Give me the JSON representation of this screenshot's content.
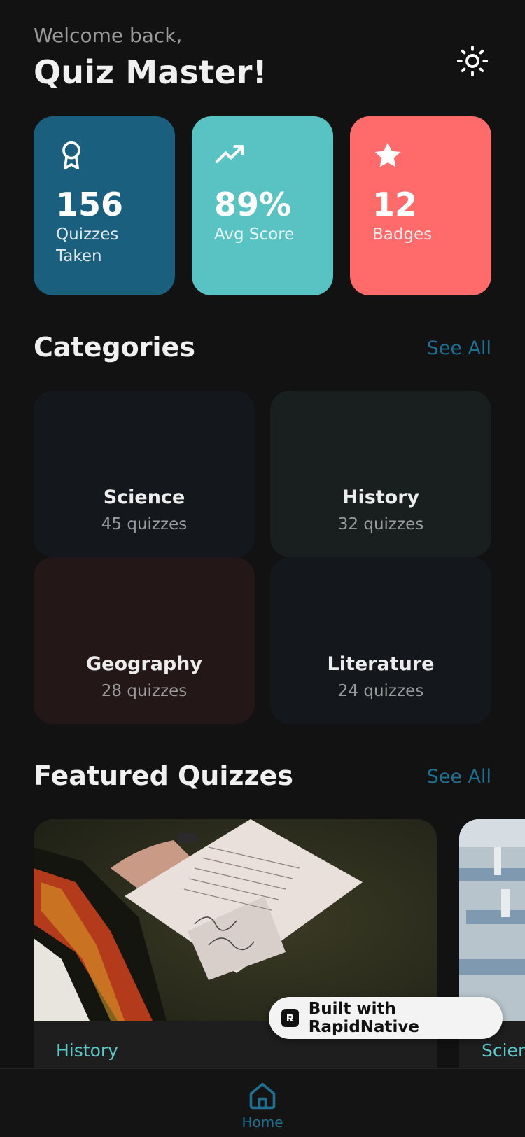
{
  "header": {
    "welcome": "Welcome back,",
    "username": "Quiz Master!",
    "theme_icon": "sun-icon"
  },
  "stats": [
    {
      "icon": "award-icon",
      "value": "156",
      "label": "Quizzes Taken",
      "color": "#1b5f7e"
    },
    {
      "icon": "trending-up-icon",
      "value": "89%",
      "label": "Avg Score",
      "color": "#59c3c4"
    },
    {
      "icon": "star-icon",
      "value": "12",
      "label": "Badges",
      "color": "#ff6b6b"
    }
  ],
  "categories_section": {
    "title": "Categories",
    "see_all": "See All",
    "items": [
      {
        "name": "Science",
        "count": "45 quizzes",
        "color": "#14181c"
      },
      {
        "name": "History",
        "count": "32 quizzes",
        "color": "#181f1e"
      },
      {
        "name": "Geography",
        "count": "28 quizzes",
        "color": "#231718"
      },
      {
        "name": "Literature",
        "count": "24 quizzes",
        "color": "#14181c"
      }
    ]
  },
  "featured_section": {
    "title": "Featured Quizzes",
    "see_all": "See All",
    "items": [
      {
        "category": "History"
      },
      {
        "category": "Science"
      }
    ]
  },
  "badge": {
    "text": "Built with RapidNative"
  },
  "nav": {
    "home_label": "Home",
    "home_icon": "home-icon"
  },
  "colors": {
    "accent": "#1e6f91",
    "teal": "#5cc8c8",
    "background": "#121212"
  }
}
